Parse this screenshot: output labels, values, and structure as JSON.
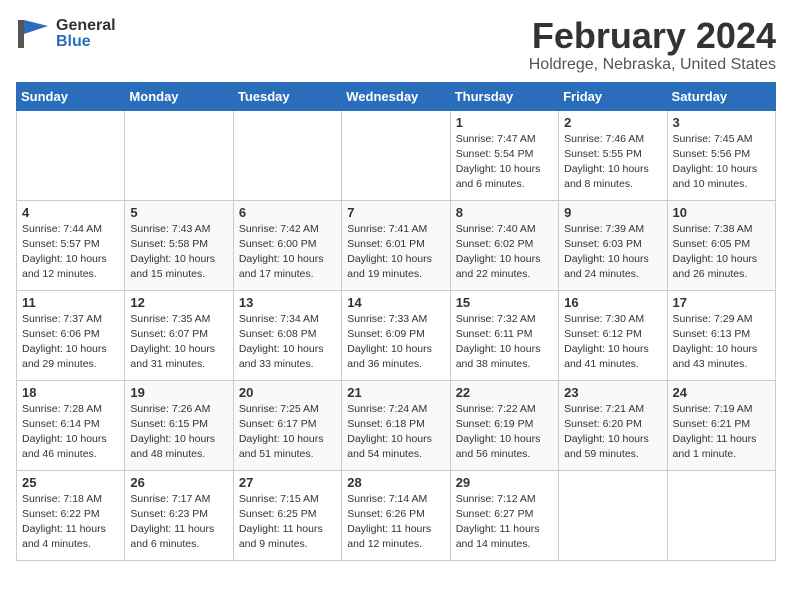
{
  "header": {
    "logo_general": "General",
    "logo_blue": "Blue",
    "title": "February 2024",
    "subtitle": "Holdrege, Nebraska, United States"
  },
  "days_of_week": [
    "Sunday",
    "Monday",
    "Tuesday",
    "Wednesday",
    "Thursday",
    "Friday",
    "Saturday"
  ],
  "weeks": [
    [
      {
        "day": "",
        "info": ""
      },
      {
        "day": "",
        "info": ""
      },
      {
        "day": "",
        "info": ""
      },
      {
        "day": "",
        "info": ""
      },
      {
        "day": "1",
        "info": "Sunrise: 7:47 AM\nSunset: 5:54 PM\nDaylight: 10 hours\nand 6 minutes."
      },
      {
        "day": "2",
        "info": "Sunrise: 7:46 AM\nSunset: 5:55 PM\nDaylight: 10 hours\nand 8 minutes."
      },
      {
        "day": "3",
        "info": "Sunrise: 7:45 AM\nSunset: 5:56 PM\nDaylight: 10 hours\nand 10 minutes."
      }
    ],
    [
      {
        "day": "4",
        "info": "Sunrise: 7:44 AM\nSunset: 5:57 PM\nDaylight: 10 hours\nand 12 minutes."
      },
      {
        "day": "5",
        "info": "Sunrise: 7:43 AM\nSunset: 5:58 PM\nDaylight: 10 hours\nand 15 minutes."
      },
      {
        "day": "6",
        "info": "Sunrise: 7:42 AM\nSunset: 6:00 PM\nDaylight: 10 hours\nand 17 minutes."
      },
      {
        "day": "7",
        "info": "Sunrise: 7:41 AM\nSunset: 6:01 PM\nDaylight: 10 hours\nand 19 minutes."
      },
      {
        "day": "8",
        "info": "Sunrise: 7:40 AM\nSunset: 6:02 PM\nDaylight: 10 hours\nand 22 minutes."
      },
      {
        "day": "9",
        "info": "Sunrise: 7:39 AM\nSunset: 6:03 PM\nDaylight: 10 hours\nand 24 minutes."
      },
      {
        "day": "10",
        "info": "Sunrise: 7:38 AM\nSunset: 6:05 PM\nDaylight: 10 hours\nand 26 minutes."
      }
    ],
    [
      {
        "day": "11",
        "info": "Sunrise: 7:37 AM\nSunset: 6:06 PM\nDaylight: 10 hours\nand 29 minutes."
      },
      {
        "day": "12",
        "info": "Sunrise: 7:35 AM\nSunset: 6:07 PM\nDaylight: 10 hours\nand 31 minutes."
      },
      {
        "day": "13",
        "info": "Sunrise: 7:34 AM\nSunset: 6:08 PM\nDaylight: 10 hours\nand 33 minutes."
      },
      {
        "day": "14",
        "info": "Sunrise: 7:33 AM\nSunset: 6:09 PM\nDaylight: 10 hours\nand 36 minutes."
      },
      {
        "day": "15",
        "info": "Sunrise: 7:32 AM\nSunset: 6:11 PM\nDaylight: 10 hours\nand 38 minutes."
      },
      {
        "day": "16",
        "info": "Sunrise: 7:30 AM\nSunset: 6:12 PM\nDaylight: 10 hours\nand 41 minutes."
      },
      {
        "day": "17",
        "info": "Sunrise: 7:29 AM\nSunset: 6:13 PM\nDaylight: 10 hours\nand 43 minutes."
      }
    ],
    [
      {
        "day": "18",
        "info": "Sunrise: 7:28 AM\nSunset: 6:14 PM\nDaylight: 10 hours\nand 46 minutes."
      },
      {
        "day": "19",
        "info": "Sunrise: 7:26 AM\nSunset: 6:15 PM\nDaylight: 10 hours\nand 48 minutes."
      },
      {
        "day": "20",
        "info": "Sunrise: 7:25 AM\nSunset: 6:17 PM\nDaylight: 10 hours\nand 51 minutes."
      },
      {
        "day": "21",
        "info": "Sunrise: 7:24 AM\nSunset: 6:18 PM\nDaylight: 10 hours\nand 54 minutes."
      },
      {
        "day": "22",
        "info": "Sunrise: 7:22 AM\nSunset: 6:19 PM\nDaylight: 10 hours\nand 56 minutes."
      },
      {
        "day": "23",
        "info": "Sunrise: 7:21 AM\nSunset: 6:20 PM\nDaylight: 10 hours\nand 59 minutes."
      },
      {
        "day": "24",
        "info": "Sunrise: 7:19 AM\nSunset: 6:21 PM\nDaylight: 11 hours\nand 1 minute."
      }
    ],
    [
      {
        "day": "25",
        "info": "Sunrise: 7:18 AM\nSunset: 6:22 PM\nDaylight: 11 hours\nand 4 minutes."
      },
      {
        "day": "26",
        "info": "Sunrise: 7:17 AM\nSunset: 6:23 PM\nDaylight: 11 hours\nand 6 minutes."
      },
      {
        "day": "27",
        "info": "Sunrise: 7:15 AM\nSunset: 6:25 PM\nDaylight: 11 hours\nand 9 minutes."
      },
      {
        "day": "28",
        "info": "Sunrise: 7:14 AM\nSunset: 6:26 PM\nDaylight: 11 hours\nand 12 minutes."
      },
      {
        "day": "29",
        "info": "Sunrise: 7:12 AM\nSunset: 6:27 PM\nDaylight: 11 hours\nand 14 minutes."
      },
      {
        "day": "",
        "info": ""
      },
      {
        "day": "",
        "info": ""
      }
    ]
  ]
}
